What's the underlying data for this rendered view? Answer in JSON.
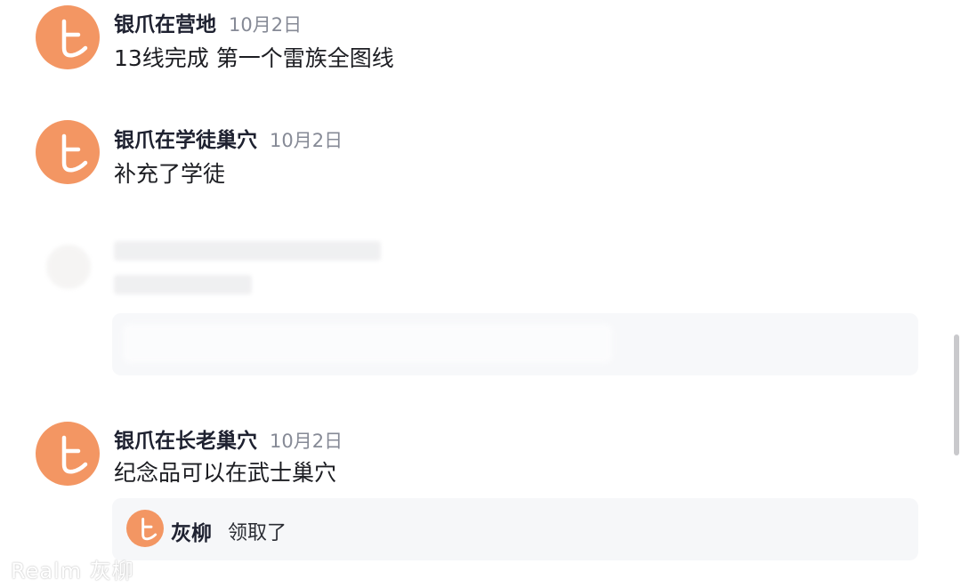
{
  "colors": {
    "avatar": "#f39663",
    "card": "#f6f7f9",
    "author": "#1e2130",
    "date": "#868a96"
  },
  "posts": [
    {
      "author": "银爪在营地",
      "date": "10月2日",
      "text": "13线完成 第一个雷族全图线",
      "avatar_icon": "yo-hiragana-icon"
    },
    {
      "author": "银爪在学徒巢穴",
      "date": "10月2日",
      "text": "补充了学徒",
      "avatar_icon": "yo-hiragana-icon"
    },
    {
      "author": "银爪在长老巢穴",
      "date": "10月2日",
      "text": "纪念品可以在武士巢穴",
      "avatar_icon": "yo-hiragana-icon"
    }
  ],
  "reply": {
    "author": "灰柳",
    "text": "领取了"
  },
  "watermark": "Realm 灰柳"
}
